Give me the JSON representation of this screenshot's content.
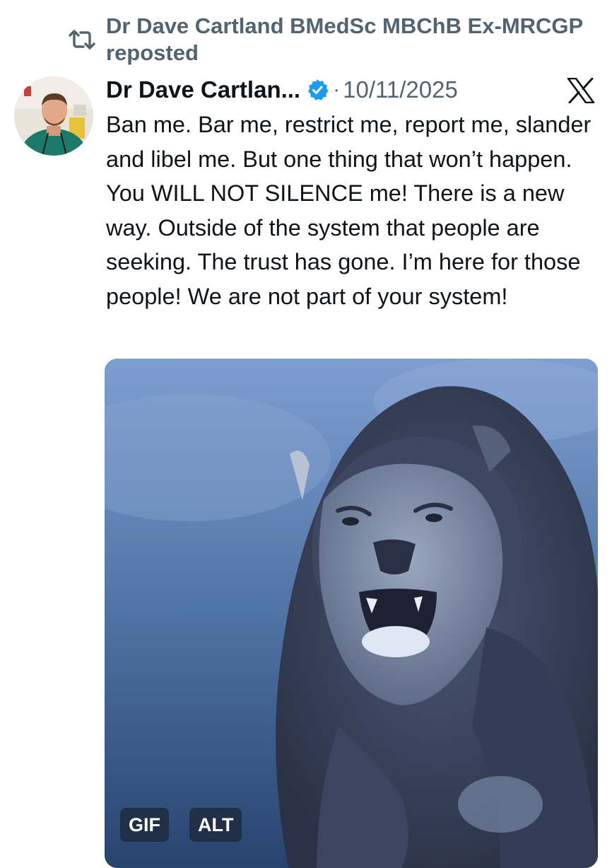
{
  "repost": {
    "text": "Dr Dave Cartland BMedSc MBChB Ex-MRCGP reposted",
    "icon": "repost-icon"
  },
  "post": {
    "author": "Dr Dave Cartlan...",
    "verified_icon": "verified-badge-icon",
    "separator": "·",
    "date": "10/11/2025",
    "platform_icon": "x-logo-icon",
    "text": "Ban me. Bar me, restrict me, report me, slander and libel me. But one thing that won’t happen. You WILL NOT SILENCE me! There is a new way. Outside of the system that people are seeking. The trust has gone. I’m here for those people! We are not part of your system!"
  },
  "media": {
    "gif_label": "GIF",
    "alt_label": "ALT"
  },
  "colors": {
    "secondary_text": "#536471",
    "verified_blue": "#1d9bf0",
    "primary_text": "#0f1419"
  }
}
